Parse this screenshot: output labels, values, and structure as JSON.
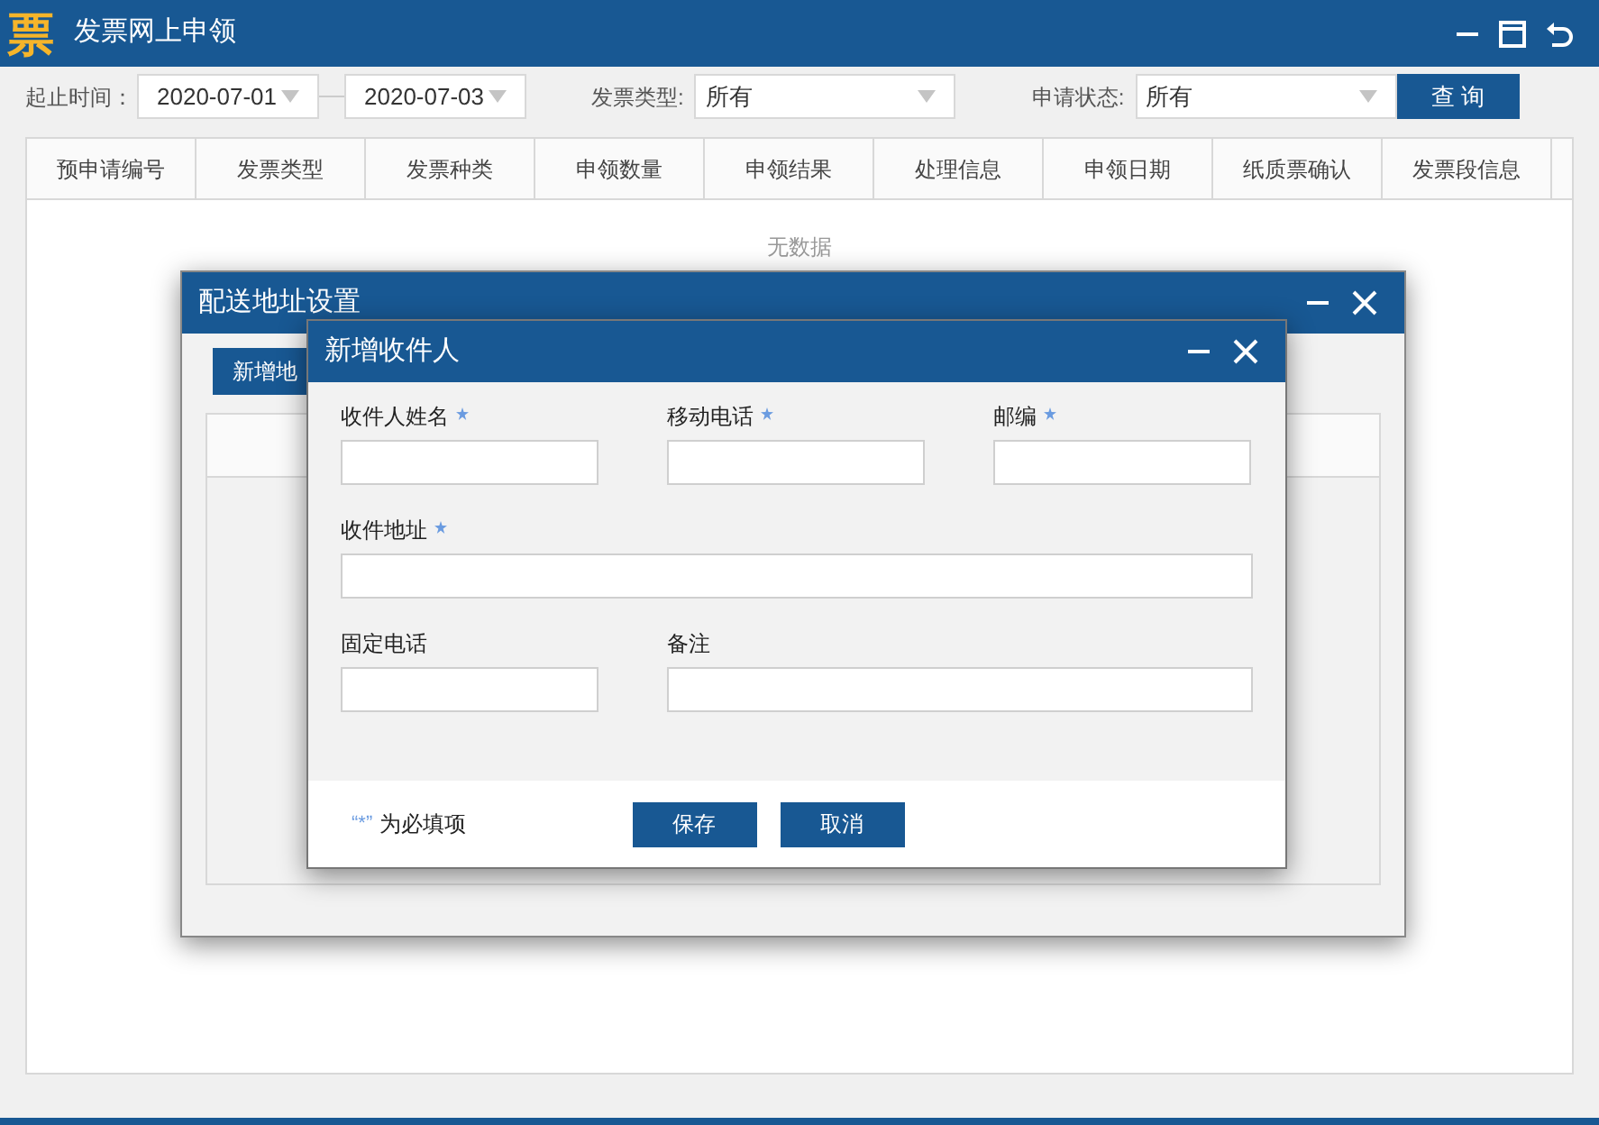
{
  "window": {
    "logo": "票",
    "title": "发票网上申领"
  },
  "filters": {
    "date_label": "起止时间：",
    "date_start": "2020-07-01",
    "date_end": "2020-07-03",
    "type_label": "发票类型:",
    "type_value": "所有",
    "status_label": "申请状态:",
    "status_value": "所有",
    "query_button": "查 询"
  },
  "table": {
    "columns": [
      "预申请编号",
      "发票类型",
      "发票种类",
      "申领数量",
      "申领结果",
      "处理信息",
      "申领日期",
      "纸质票确认",
      "发票段信息"
    ],
    "empty_text": "无数据"
  },
  "address_dialog": {
    "title": "配送地址设置",
    "add_button": "新增地"
  },
  "recipient_dialog": {
    "title": "新增收件人",
    "rows": [
      [
        {
          "label": "收件人姓名",
          "required": true
        },
        {
          "label": "移动电话",
          "required": true
        },
        {
          "label": "邮编",
          "required": true
        }
      ],
      [
        {
          "label": "收件地址",
          "required": true
        }
      ],
      [
        {
          "label": "固定电话",
          "required": false
        },
        {
          "label": "备注",
          "required": false
        }
      ]
    ],
    "note_mark": "“*”",
    "note": "为必填项",
    "buttons": [
      "保存",
      "取消"
    ]
  }
}
